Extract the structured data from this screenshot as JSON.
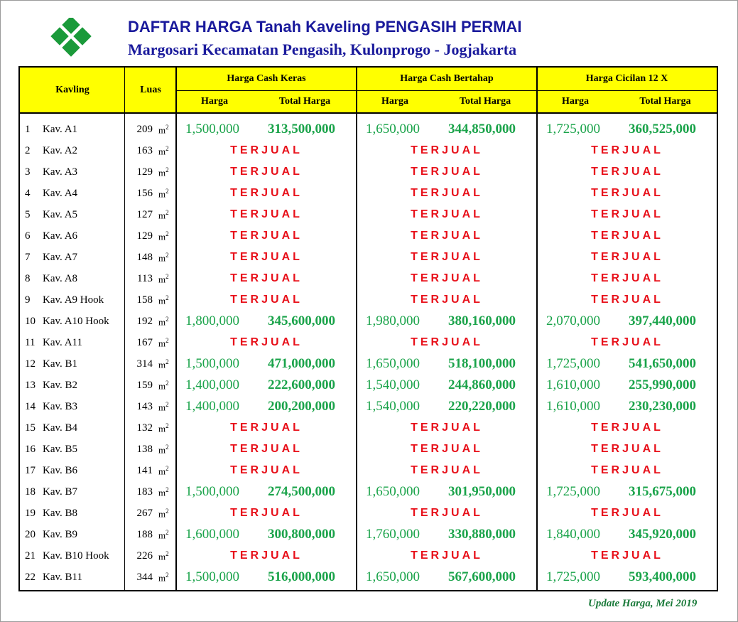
{
  "header": {
    "title": "DAFTAR HARGA Tanah Kaveling PENGASIH PERMAI",
    "subtitle": "Margosari Kecamatan Pengasih, Kulonprogo - Jogjakarta",
    "logo_color": "#1a9a3a",
    "title_color": "#1a1a9c"
  },
  "table": {
    "col_kavling": "Kavling",
    "col_luas": "Luas",
    "group_cash_keras": "Harga Cash Keras",
    "group_cash_bertahap": "Harga Cash Bertahap",
    "group_cicilan": "Harga Cicilan 12 X",
    "sub_harga": "Harga",
    "sub_total": "Total Harga",
    "unit": "m",
    "unit_sup": "2",
    "sold_label": "TERJUAL",
    "header_bg": "#ffff00",
    "price_color": "#1aa34a",
    "sold_color": "#e8101a",
    "rows": [
      {
        "no": "1",
        "kav": "Kav. A1",
        "luas": "209",
        "sold": false,
        "ck_h": "1,500,000",
        "ck_t": "313,500,000",
        "cb_h": "1,650,000",
        "cb_t": "344,850,000",
        "ci_h": "1,725,000",
        "ci_t": "360,525,000"
      },
      {
        "no": "2",
        "kav": "Kav. A2",
        "luas": "163",
        "sold": true
      },
      {
        "no": "3",
        "kav": "Kav. A3",
        "luas": "129",
        "sold": true
      },
      {
        "no": "4",
        "kav": "Kav. A4",
        "luas": "156",
        "sold": true
      },
      {
        "no": "5",
        "kav": "Kav. A5",
        "luas": "127",
        "sold": true
      },
      {
        "no": "6",
        "kav": "Kav. A6",
        "luas": "129",
        "sold": true
      },
      {
        "no": "7",
        "kav": "Kav. A7",
        "luas": "148",
        "sold": true
      },
      {
        "no": "8",
        "kav": "Kav. A8",
        "luas": "113",
        "sold": true
      },
      {
        "no": "9",
        "kav": "Kav. A9 Hook",
        "luas": "158",
        "sold": true
      },
      {
        "no": "10",
        "kav": "Kav. A10 Hook",
        "luas": "192",
        "sold": false,
        "ck_h": "1,800,000",
        "ck_t": "345,600,000",
        "cb_h": "1,980,000",
        "cb_t": "380,160,000",
        "ci_h": "2,070,000",
        "ci_t": "397,440,000"
      },
      {
        "no": "11",
        "kav": "Kav. A11",
        "luas": "167",
        "sold": true
      },
      {
        "no": "12",
        "kav": "Kav. B1",
        "luas": "314",
        "sold": false,
        "ck_h": "1,500,000",
        "ck_t": "471,000,000",
        "cb_h": "1,650,000",
        "cb_t": "518,100,000",
        "ci_h": "1,725,000",
        "ci_t": "541,650,000"
      },
      {
        "no": "13",
        "kav": "Kav. B2",
        "luas": "159",
        "sold": false,
        "ck_h": "1,400,000",
        "ck_t": "222,600,000",
        "cb_h": "1,540,000",
        "cb_t": "244,860,000",
        "ci_h": "1,610,000",
        "ci_t": "255,990,000"
      },
      {
        "no": "14",
        "kav": "Kav. B3",
        "luas": "143",
        "sold": false,
        "ck_h": "1,400,000",
        "ck_t": "200,200,000",
        "cb_h": "1,540,000",
        "cb_t": "220,220,000",
        "ci_h": "1,610,000",
        "ci_t": "230,230,000"
      },
      {
        "no": "15",
        "kav": "Kav. B4",
        "luas": "132",
        "sold": true
      },
      {
        "no": "16",
        "kav": "Kav. B5",
        "luas": "138",
        "sold": true
      },
      {
        "no": "17",
        "kav": "Kav. B6",
        "luas": "141",
        "sold": true
      },
      {
        "no": "18",
        "kav": "Kav. B7",
        "luas": "183",
        "sold": false,
        "ck_h": "1,500,000",
        "ck_t": "274,500,000",
        "cb_h": "1,650,000",
        "cb_t": "301,950,000",
        "ci_h": "1,725,000",
        "ci_t": "315,675,000"
      },
      {
        "no": "19",
        "kav": "Kav. B8",
        "luas": "267",
        "sold": true
      },
      {
        "no": "20",
        "kav": "Kav. B9",
        "luas": "188",
        "sold": false,
        "ck_h": "1,600,000",
        "ck_t": "300,800,000",
        "cb_h": "1,760,000",
        "cb_t": "330,880,000",
        "ci_h": "1,840,000",
        "ci_t": "345,920,000"
      },
      {
        "no": "21",
        "kav": "Kav. B10 Hook",
        "luas": "226",
        "sold": true
      },
      {
        "no": "22",
        "kav": "Kav. B11",
        "luas": "344",
        "sold": false,
        "ck_h": "1,500,000",
        "ck_t": "516,000,000",
        "cb_h": "1,650,000",
        "cb_t": "567,600,000",
        "ci_h": "1,725,000",
        "ci_t": "593,400,000"
      }
    ]
  },
  "footer": {
    "update_text": "Update Harga, Mei 2019"
  }
}
